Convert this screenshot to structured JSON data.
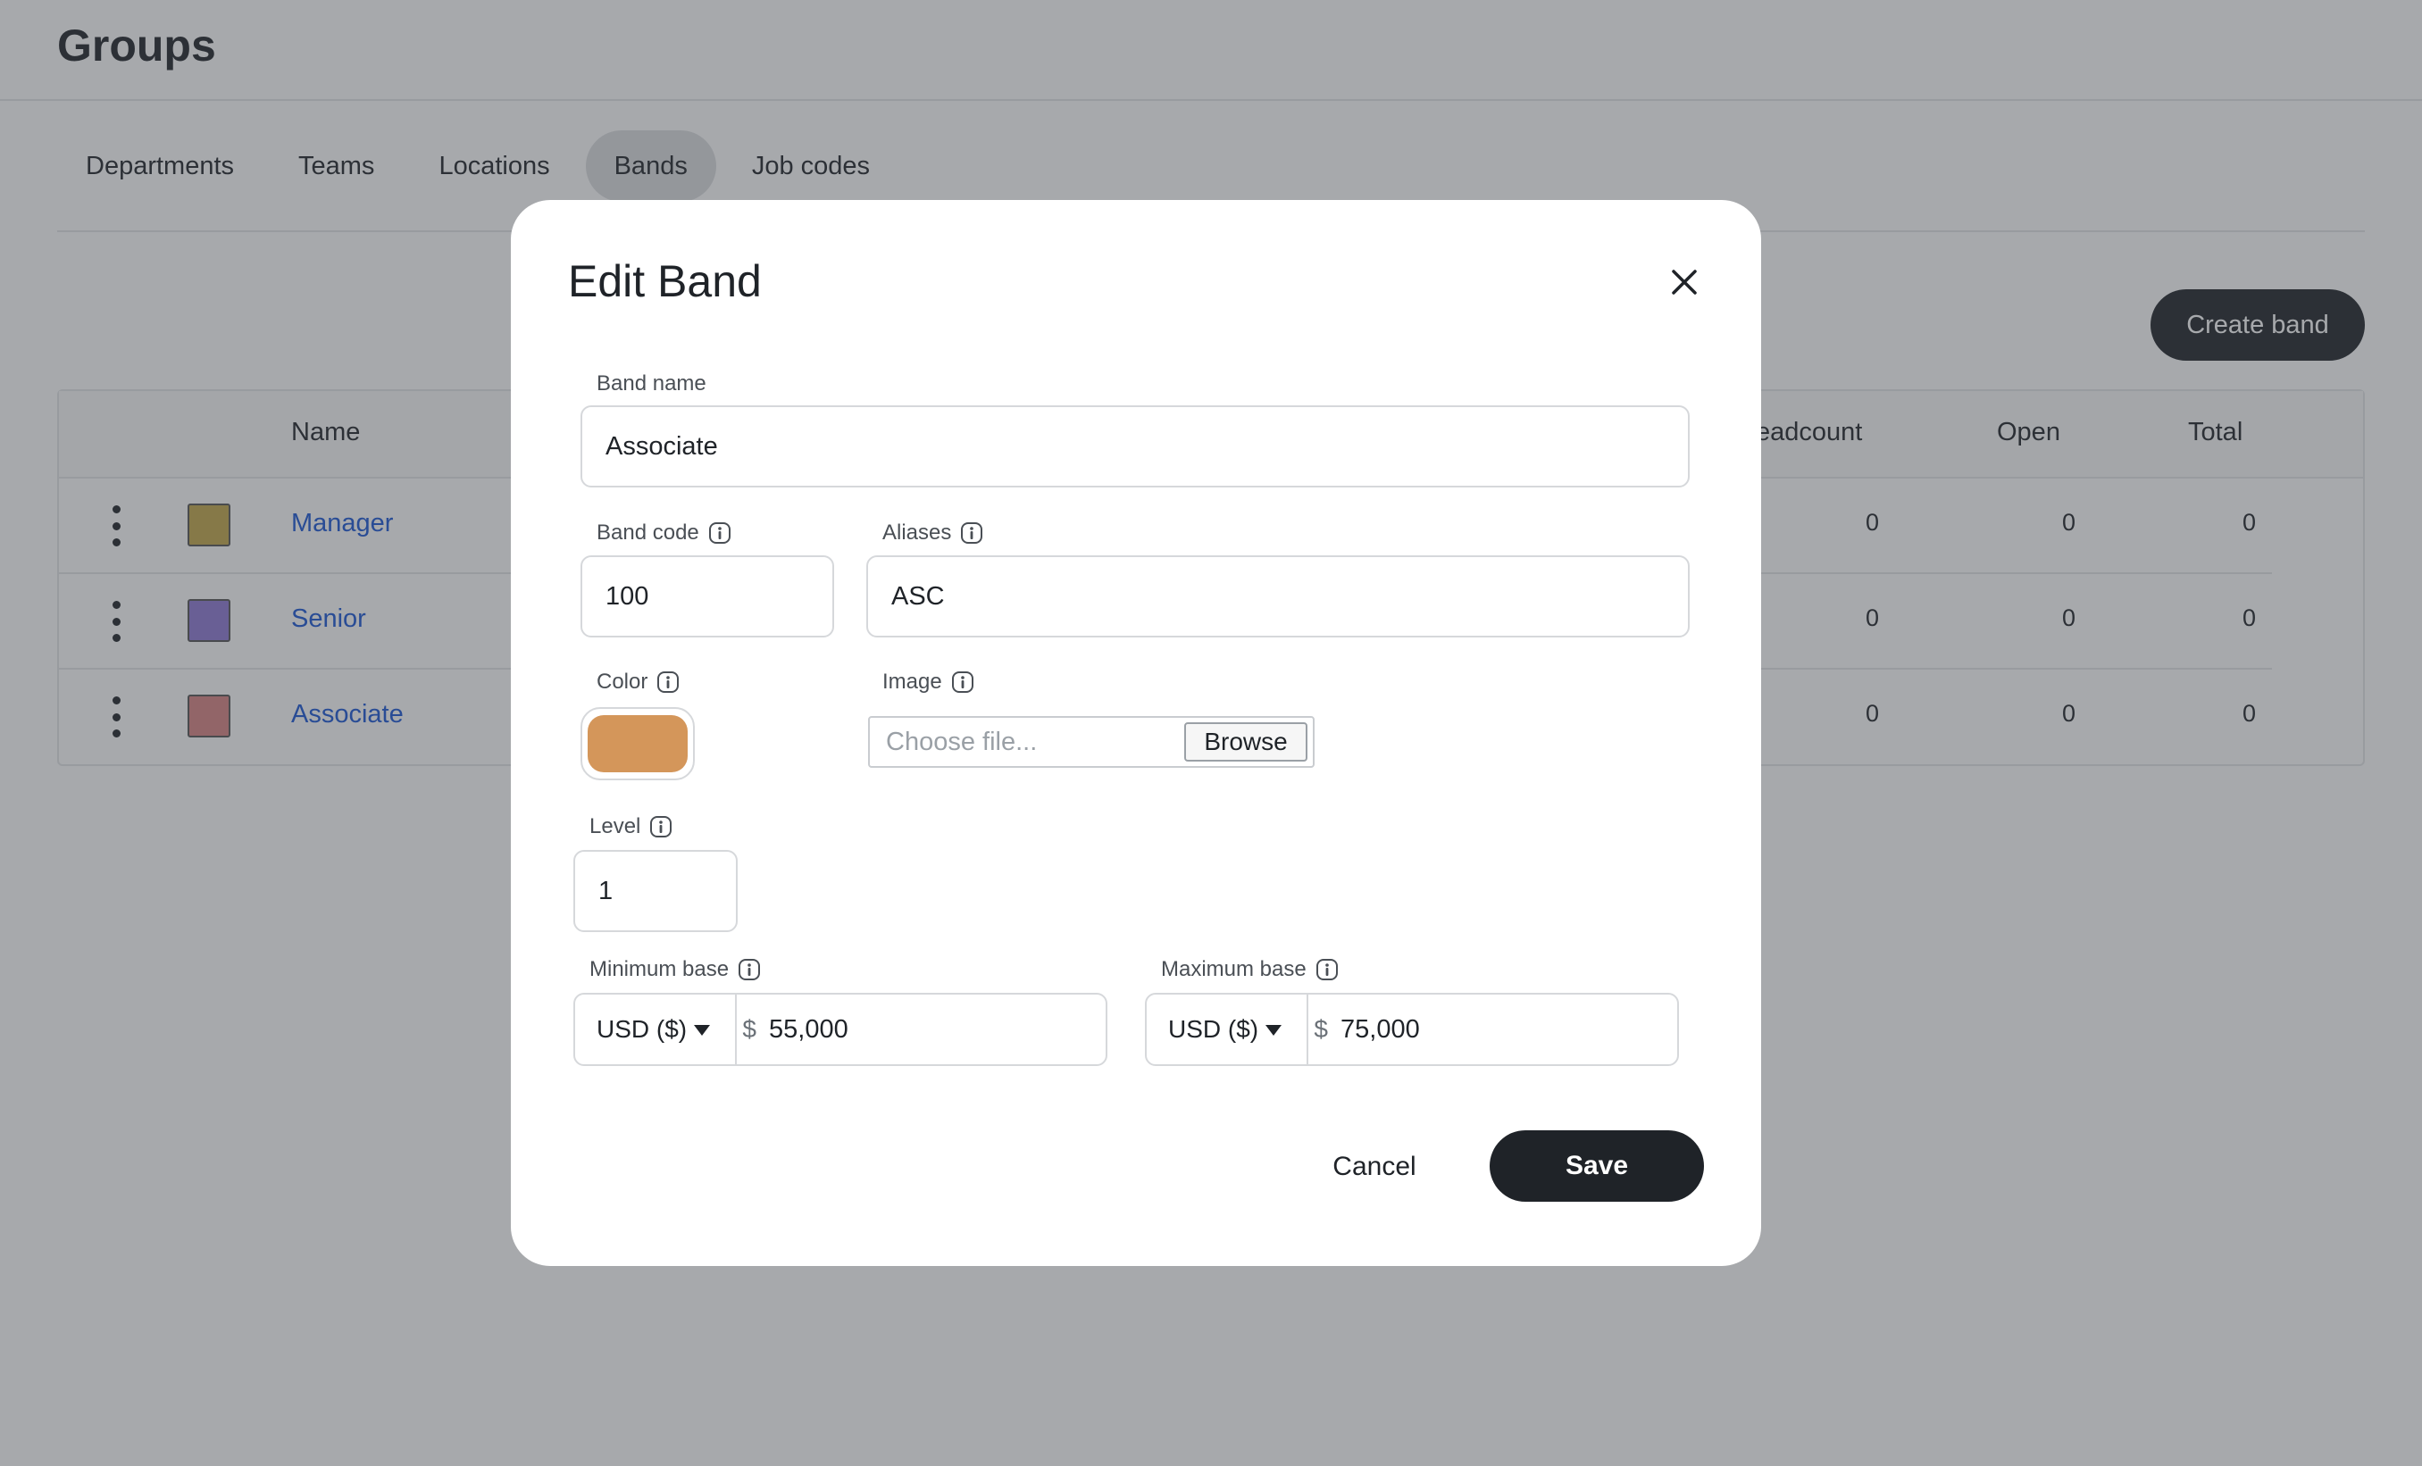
{
  "page": {
    "title": "Groups"
  },
  "tabs": [
    {
      "label": "Departments"
    },
    {
      "label": "Teams"
    },
    {
      "label": "Locations"
    },
    {
      "label": "Bands",
      "active": true
    },
    {
      "label": "Job codes"
    }
  ],
  "toolbar": {
    "create_label": "Create band"
  },
  "table": {
    "headers": {
      "name": "Name",
      "headcount": "eadcount",
      "open": "Open",
      "total": "Total"
    },
    "rows": [
      {
        "name": "Manager",
        "color": "#c3a84a",
        "headcount": "0",
        "open": "0",
        "total": "0"
      },
      {
        "name": "Senior",
        "color": "#8f78d6",
        "headcount": "0",
        "open": "0",
        "total": "0"
      },
      {
        "name": "Associate",
        "color": "#d98484",
        "headcount": "0",
        "open": "0",
        "total": "0"
      }
    ]
  },
  "modal": {
    "title": "Edit Band",
    "band_name": {
      "label": "Band name",
      "value": "Associate"
    },
    "band_code": {
      "label": "Band code",
      "value": "100"
    },
    "aliases": {
      "label": "Aliases",
      "value": "ASC"
    },
    "color": {
      "label": "Color",
      "value": "#d4965a"
    },
    "image": {
      "label": "Image",
      "placeholder": "Choose file...",
      "browse_label": "Browse"
    },
    "level": {
      "label": "Level",
      "value": "1"
    },
    "min_base": {
      "label": "Minimum base",
      "currency": "USD ($)",
      "symbol": "$",
      "value": "55,000"
    },
    "max_base": {
      "label": "Maximum base",
      "currency": "USD ($)",
      "symbol": "$",
      "value": "75,000"
    },
    "cancel_label": "Cancel",
    "save_label": "Save"
  },
  "icons": {
    "close": "close-icon",
    "info": "info-icon",
    "kebab": "kebab-menu-icon",
    "caret": "caret-down-icon"
  },
  "colors": {
    "primary": "#1f2328",
    "link": "#1a57d6",
    "overlay": "rgba(60,64,70,0.45)"
  }
}
